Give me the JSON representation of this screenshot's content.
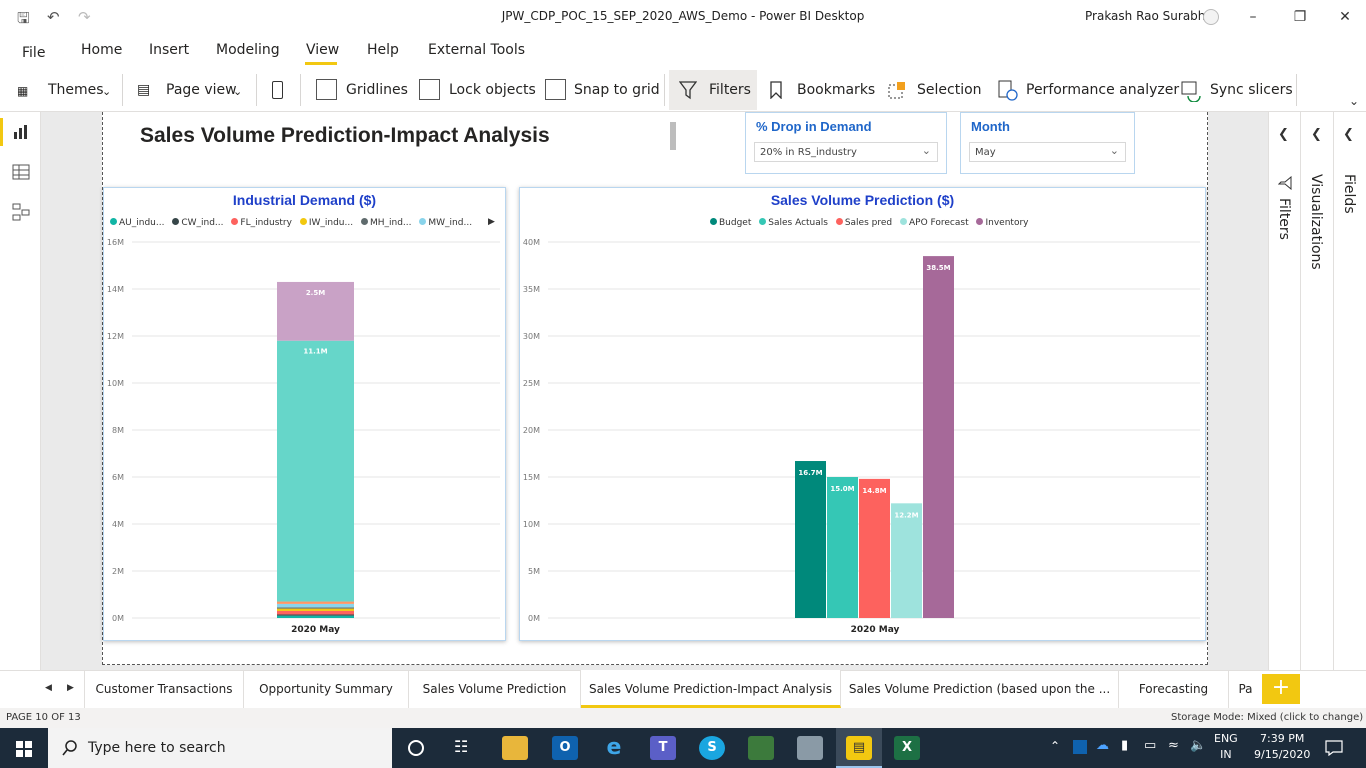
{
  "window": {
    "title": "JPW_CDP_POC_15_SEP_2020_AWS_Demo - Power BI Desktop",
    "user": "Prakash Rao Surabhi"
  },
  "menu": [
    "File",
    "Home",
    "Insert",
    "Modeling",
    "View",
    "Help",
    "External Tools"
  ],
  "toolbar": {
    "themes": "Themes",
    "page_view": "Page view",
    "gridlines": "Gridlines",
    "lock_objects": "Lock objects",
    "snap_to_grid": "Snap to grid",
    "filters": "Filters",
    "bookmarks": "Bookmarks",
    "selection": "Selection",
    "performance_analyzer": "Performance analyzer",
    "sync_slicers": "Sync slicers"
  },
  "report": {
    "title": "Sales Volume Prediction-Impact Analysis",
    "slicer_drop": {
      "label": "% Drop in Demand",
      "value": "20% in RS_industry"
    },
    "slicer_month": {
      "label": "Month",
      "value": "May"
    }
  },
  "panes": {
    "filters": "Filters",
    "visualizations": "Visualizations",
    "fields": "Fields"
  },
  "tabs": [
    "Customer Transactions",
    "Opportunity Summary",
    "Sales Volume Prediction",
    "Sales Volume Prediction-Impact Analysis",
    "Sales Volume Prediction (based upon the ...",
    "Forecasting",
    "Pa"
  ],
  "active_tab": 3,
  "status": {
    "page": "PAGE 10 OF 13",
    "storage": "Storage Mode: Mixed (click to change)"
  },
  "taskbar": {
    "search_placeholder": "Type here to search",
    "lang1": "ENG",
    "lang2": "IN",
    "time": "7:39 PM",
    "date": "9/15/2020"
  },
  "colors": {
    "accent": "#f2c811",
    "title_blue": "#1f40c9"
  },
  "chart_data": [
    {
      "type": "bar",
      "stacked": true,
      "title": "Industrial Demand ($)",
      "categories": [
        "2020 May"
      ],
      "yticks": [
        "0M",
        "2M",
        "4M",
        "6M",
        "8M",
        "10M",
        "12M",
        "14M",
        "16M"
      ],
      "ylim": [
        0,
        16
      ],
      "unit": "M",
      "series": [
        {
          "name": "AU_indu...",
          "color": "#11b5a5",
          "values": [
            0.1
          ],
          "label": ""
        },
        {
          "name": "CW_ind...",
          "color": "#374649",
          "values": [
            0.05
          ],
          "label": ""
        },
        {
          "name": "FL_industry",
          "color": "#fd625e",
          "values": [
            0.15
          ],
          "label": ""
        },
        {
          "name": "IW_indu...",
          "color": "#f2c80f",
          "values": [
            0.1
          ],
          "label": ""
        },
        {
          "name": "MH_ind...",
          "color": "#5f6b6d",
          "values": [
            0.05
          ],
          "label": ""
        },
        {
          "name": "MW_ind...",
          "color": "#8ad4eb",
          "values": [
            0.15
          ],
          "label": ""
        },
        {
          "name": "",
          "color": "#fe9666",
          "values": [
            0.1
          ],
          "label": ""
        },
        {
          "name": "",
          "color": "#66d6c9",
          "values": [
            11.1
          ],
          "label": "11.1M"
        },
        {
          "name": "",
          "color": "#c9a2c6",
          "values": [
            2.5
          ],
          "label": "2.5M"
        }
      ],
      "legend": "top"
    },
    {
      "type": "bar",
      "title": "Sales Volume Prediction ($)",
      "categories": [
        "2020 May"
      ],
      "yticks": [
        "0M",
        "5M",
        "10M",
        "15M",
        "20M",
        "25M",
        "30M",
        "35M",
        "40M"
      ],
      "ylim": [
        0,
        40
      ],
      "unit": "M",
      "series": [
        {
          "name": "Budget",
          "color": "#00897b",
          "values": [
            16.7
          ],
          "label": "16.7M"
        },
        {
          "name": "Sales Actuals",
          "color": "#35c7b5",
          "values": [
            15.0
          ],
          "label": "15.0M"
        },
        {
          "name": "Sales pred",
          "color": "#fd625e",
          "values": [
            14.8
          ],
          "label": "14.8M"
        },
        {
          "name": "APO  Forecast",
          "color": "#9ee3dd",
          "values": [
            12.2
          ],
          "label": "12.2M"
        },
        {
          "name": "Inventory",
          "color": "#a66999",
          "values": [
            38.5
          ],
          "label": "38.5M"
        }
      ],
      "legend": "top"
    }
  ]
}
